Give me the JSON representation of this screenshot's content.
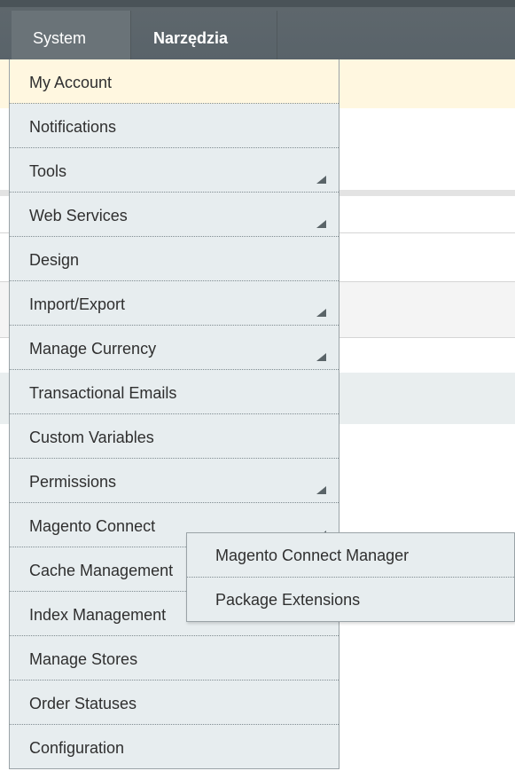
{
  "topnav": {
    "tabs": [
      {
        "label": "System"
      },
      {
        "label": "Narzędzia"
      }
    ]
  },
  "system_menu": {
    "items": [
      {
        "label": "My Account",
        "has_submenu": false
      },
      {
        "label": "Notifications",
        "has_submenu": false
      },
      {
        "label": "Tools",
        "has_submenu": true
      },
      {
        "label": "Web Services",
        "has_submenu": true
      },
      {
        "label": "Design",
        "has_submenu": false
      },
      {
        "label": "Import/Export",
        "has_submenu": true
      },
      {
        "label": "Manage Currency",
        "has_submenu": true
      },
      {
        "label": "Transactional Emails",
        "has_submenu": false
      },
      {
        "label": "Custom Variables",
        "has_submenu": false
      },
      {
        "label": "Permissions",
        "has_submenu": true
      },
      {
        "label": "Magento Connect",
        "has_submenu": true
      },
      {
        "label": "Cache Management",
        "has_submenu": false
      },
      {
        "label": "Index Management",
        "has_submenu": false
      },
      {
        "label": "Manage Stores",
        "has_submenu": false
      },
      {
        "label": "Order Statuses",
        "has_submenu": false
      },
      {
        "label": "Configuration",
        "has_submenu": false
      }
    ]
  },
  "connect_submenu": {
    "items": [
      {
        "label": "Magento Connect Manager"
      },
      {
        "label": "Package Extensions"
      }
    ]
  },
  "colors": {
    "topbar": "#59636a",
    "menu_bg": "#e7edef",
    "highlight": "#fff7e0",
    "text": "#2f2f2f"
  }
}
